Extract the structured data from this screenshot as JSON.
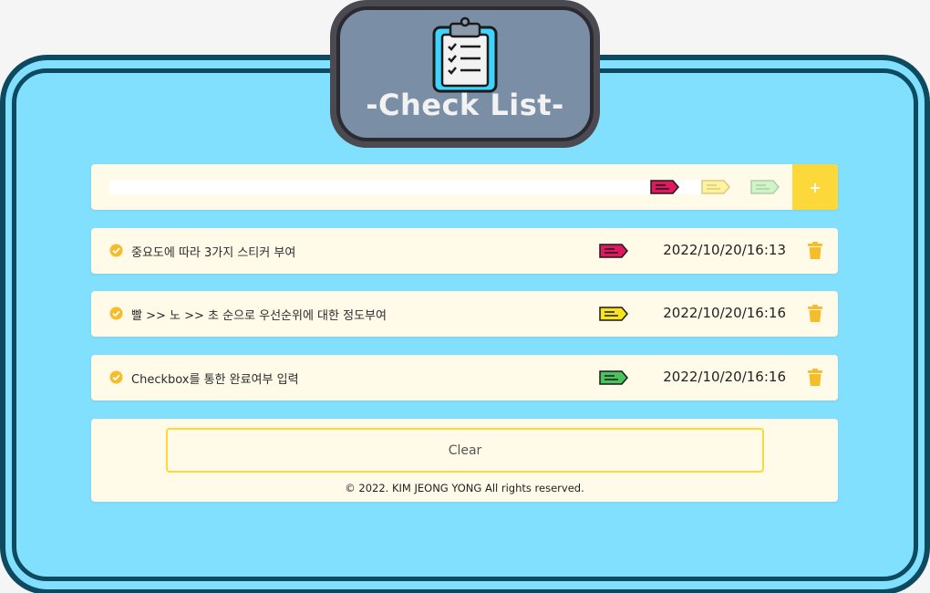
{
  "header": {
    "title": "-Check List-",
    "icon": "clipboard-checklist-icon"
  },
  "input": {
    "value": "",
    "placeholder": "",
    "stickers": [
      {
        "name": "red-sticker",
        "color": "#e0195e",
        "selected": true
      },
      {
        "name": "yellow-sticker",
        "color": "#fff2a0",
        "selected": false
      },
      {
        "name": "green-sticker",
        "color": "#d3f2cc",
        "selected": false
      }
    ],
    "add_label": "+"
  },
  "tasks": [
    {
      "text": "중요도에 따라 3가지 스티커 부여",
      "sticker_color": "#e0195e",
      "date": "2022/10/20/16:13",
      "done": true
    },
    {
      "text": "빨 >> 노 >> 초 순으로 우선순위에 대한 정도부여",
      "sticker_color": "#f7e41d",
      "date": "2022/10/20/16:16",
      "done": true
    },
    {
      "text": "Checkbox를 통한 완료여부 입력",
      "sticker_color": "#4cc25e",
      "date": "2022/10/20/16:16",
      "done": true
    }
  ],
  "footer": {
    "clear_label": "Clear",
    "copyright": "© 2022. KIM JEONG YONG All rights reserved."
  },
  "colors": {
    "accent": "#fdd83a",
    "background": "#82e0ff",
    "frame": "#0d4a5f",
    "card": "#fffbe8"
  }
}
